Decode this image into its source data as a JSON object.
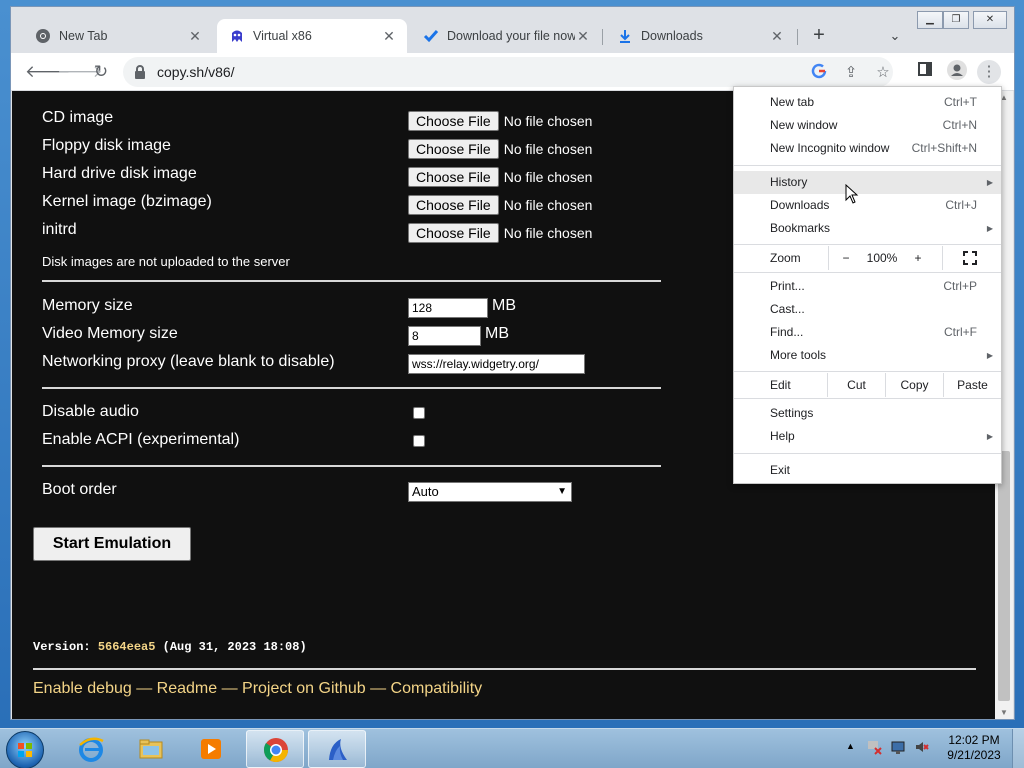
{
  "browser": {
    "tabs": [
      {
        "title": "New Tab",
        "icon": "chrome-icon"
      },
      {
        "title": "Virtual x86",
        "icon": "v86-icon",
        "active": true
      },
      {
        "title": "Download your file now",
        "icon": "check-icon"
      },
      {
        "title": "Downloads",
        "icon": "download-icon"
      }
    ],
    "url": "copy.sh/v86/"
  },
  "form": {
    "file_rows": [
      {
        "label": "CD image",
        "button": "Choose File",
        "status": "No file chosen"
      },
      {
        "label": "Floppy disk image",
        "button": "Choose File",
        "status": "No file chosen"
      },
      {
        "label": "Hard drive disk image",
        "button": "Choose File",
        "status": "No file chosen"
      },
      {
        "label": "Kernel image (bzimage)",
        "button": "Choose File",
        "status": "No file chosen"
      },
      {
        "label": "initrd",
        "button": "Choose File",
        "status": "No file chosen"
      }
    ],
    "disk_note": "Disk images are not uploaded to the server",
    "memory_label": "Memory size",
    "memory_value": "128",
    "memory_unit": "MB",
    "vmem_label": "Video Memory size",
    "vmem_value": "8",
    "vmem_unit": "MB",
    "proxy_label": "Networking proxy (leave blank to disable)",
    "proxy_value": "wss://relay.widgetry.org/",
    "audio_label": "Disable audio",
    "acpi_label": "Enable ACPI (experimental)",
    "boot_label": "Boot order",
    "boot_value": "Auto",
    "start_label": "Start Emulation"
  },
  "footer": {
    "version_prefix": "Version: ",
    "version_hash": "5664eea5",
    "version_date": " (Aug 31, 2023 18:08)",
    "links": [
      "Enable debug",
      "Readme",
      "Project on Github",
      "Compatibility"
    ],
    "separator": " — "
  },
  "menu": {
    "items": [
      {
        "label": "New tab",
        "shortcut": "Ctrl+T"
      },
      {
        "label": "New window",
        "shortcut": "Ctrl+N"
      },
      {
        "label": "New Incognito window",
        "shortcut": "Ctrl+Shift+N"
      },
      {
        "label": "History",
        "shortcut": ""
      },
      {
        "label": "Downloads",
        "shortcut": "Ctrl+J"
      },
      {
        "label": "Bookmarks",
        "shortcut": ""
      },
      {
        "label": "Print...",
        "shortcut": "Ctrl+P"
      },
      {
        "label": "Cast...",
        "shortcut": ""
      },
      {
        "label": "Find...",
        "shortcut": "Ctrl+F"
      },
      {
        "label": "More tools",
        "shortcut": ""
      },
      {
        "label": "Settings",
        "shortcut": ""
      },
      {
        "label": "Help",
        "shortcut": ""
      },
      {
        "label": "Exit",
        "shortcut": ""
      }
    ],
    "zoom_label": "Zoom",
    "zoom_minus": "−",
    "zoom_value": "100%",
    "zoom_plus": "+",
    "edit_label": "Edit",
    "edit_cut": "Cut",
    "edit_copy": "Copy",
    "edit_paste": "Paste"
  },
  "taskbar": {
    "clock_time": "12:02 PM",
    "clock_date": "9/21/2023",
    "apps": [
      "internet-explorer-icon",
      "file-explorer-icon",
      "media-player-icon",
      "chrome-icon",
      "shark-app-icon"
    ]
  },
  "colors": {
    "page_bg": "#101010",
    "link": "#f3d487",
    "accent": "#1a73e8"
  }
}
